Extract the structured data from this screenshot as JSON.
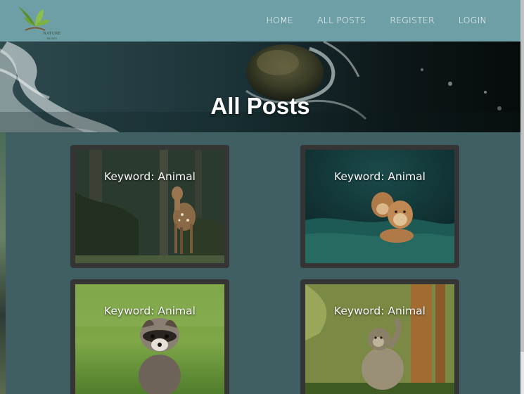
{
  "brand": {
    "logo_text": "NATURE",
    "logo_sub": "BLOGS"
  },
  "nav": {
    "items": [
      "HOME",
      "ALL POSTS",
      "REGISTER",
      "LOGIN"
    ]
  },
  "hero": {
    "title": "All Posts"
  },
  "posts": [
    {
      "keyword_label": "Keyword: Animal",
      "image": "deer"
    },
    {
      "keyword_label": "Keyword: Animal",
      "image": "lions"
    },
    {
      "keyword_label": "Keyword: Animal",
      "image": "raccoon"
    },
    {
      "keyword_label": "Keyword: Animal",
      "image": "monkey"
    }
  ],
  "colors": {
    "navbar": "#6e9fa6",
    "background": "#3f5f63",
    "card": "#353535"
  }
}
